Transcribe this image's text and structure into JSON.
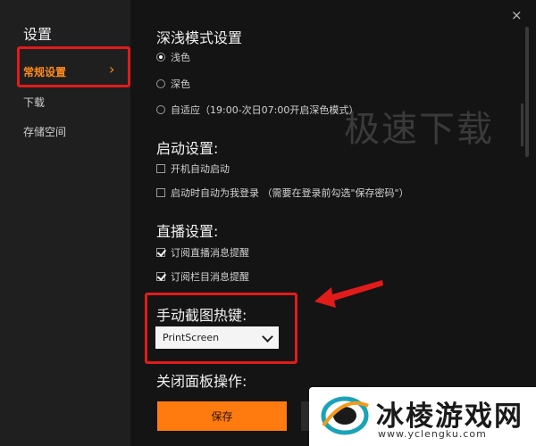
{
  "sidebar": {
    "title": "设置",
    "items": [
      {
        "label": "常规设置",
        "active": true
      },
      {
        "label": "下载"
      },
      {
        "label": "存储空间"
      }
    ]
  },
  "window": {
    "close_icon": "×"
  },
  "theme": {
    "title": "深浅模式设置",
    "options": [
      {
        "label": "浅色",
        "selected": true
      },
      {
        "label": "深色",
        "selected": false
      },
      {
        "label": "自适应（19:00-次日07:00开启深色模式）",
        "selected": false
      }
    ]
  },
  "startup": {
    "title": "启动设置:",
    "options": [
      {
        "label": "开机自动启动",
        "checked": false
      },
      {
        "label": "启动时自动为我登录 （需要在登录前勾选\"保存密码\"）",
        "checked": false
      }
    ]
  },
  "live": {
    "title": "直播设置:",
    "options": [
      {
        "label": "订阅直播消息提醒",
        "checked": true
      },
      {
        "label": "订阅栏目消息提醒",
        "checked": true
      }
    ]
  },
  "hotkey": {
    "title": "手动截图热键:",
    "value": "PrintScreen"
  },
  "close_panel": {
    "title": "关闭面板操作:"
  },
  "footer": {
    "save_label": "保存"
  },
  "watermark": {
    "text": "极速下载"
  },
  "logo": {
    "name": "冰棱游戏网",
    "url": "www.yclengku.com"
  },
  "colors": {
    "accent": "#ff7b0f",
    "highlight": "#e21b1b"
  }
}
